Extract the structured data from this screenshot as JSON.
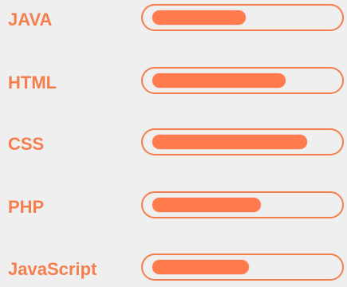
{
  "colors": {
    "accent": "#f47e4e",
    "fill": "#ff7a4d",
    "background": "#efefef"
  },
  "skills": [
    {
      "label": "JAVA",
      "level": 0.53
    },
    {
      "label": "HTML",
      "level": 0.76
    },
    {
      "label": "CSS",
      "level": 0.88
    },
    {
      "label": "PHP",
      "level": 0.62
    },
    {
      "label": "JavaScript",
      "level": 0.55
    }
  ]
}
